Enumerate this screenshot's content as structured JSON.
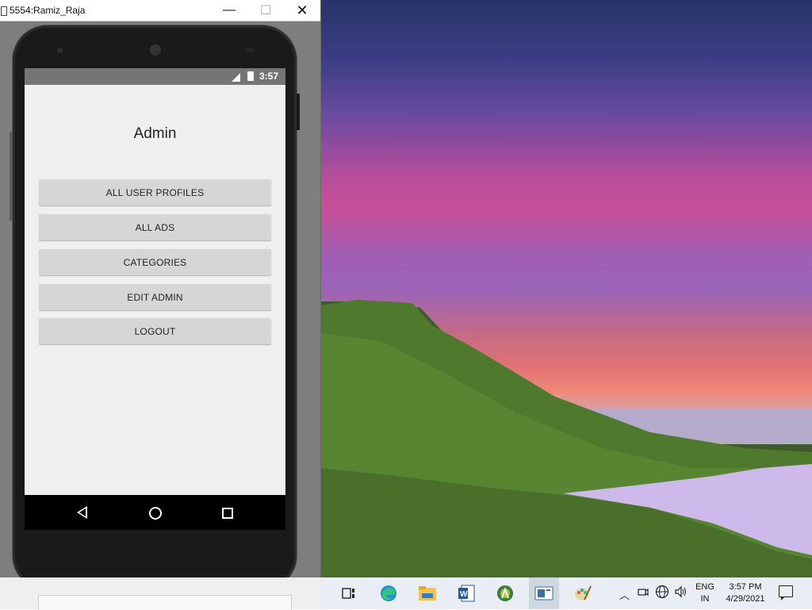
{
  "window": {
    "title": "5554:Ramiz_Raja",
    "minimize": "—",
    "maximize": "☐",
    "close": "✕"
  },
  "status_bar": {
    "time": "3:57"
  },
  "app": {
    "title": "Admin",
    "buttons": [
      {
        "label": "ALL USER PROFILES"
      },
      {
        "label": "ALL ADS"
      },
      {
        "label": "CATEGORIES"
      },
      {
        "label": "EDIT ADMIN"
      },
      {
        "label": "LOGOUT"
      }
    ]
  },
  "taskbar": {
    "icons": [
      "task-view-icon",
      "edge-icon",
      "file-explorer-icon",
      "word-icon",
      "android-studio-icon",
      "emulator-icon",
      "paint-icon"
    ],
    "language": {
      "line1": "ENG",
      "line2": "IN"
    },
    "clock": {
      "time": "3:57 PM",
      "date": "4/29/2021"
    }
  }
}
